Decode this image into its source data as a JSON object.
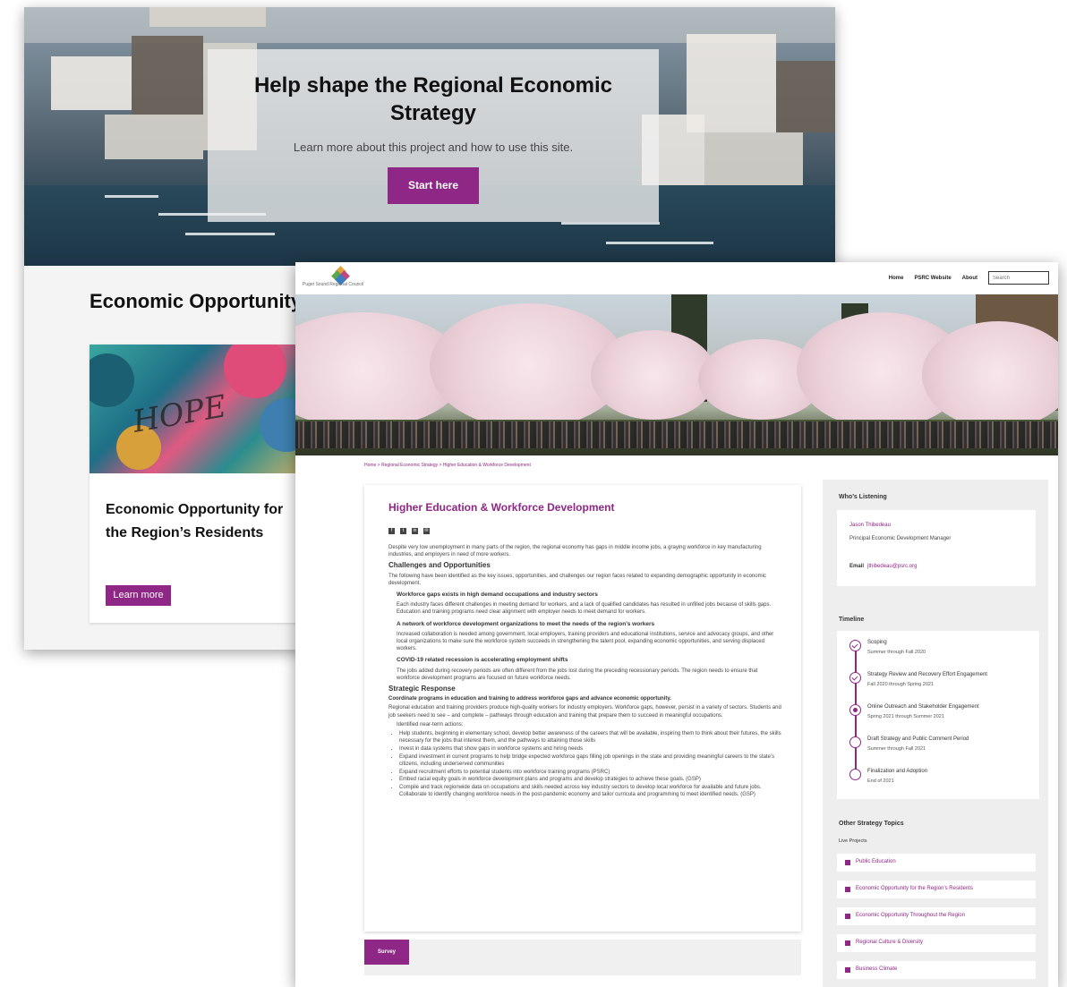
{
  "back": {
    "hero": {
      "title": "Help shape the Regional Economic Strategy",
      "subtitle": "Learn more about this project and how to use this site.",
      "button": "Start here"
    },
    "section_heading": "Economic Opportunity",
    "card": {
      "image_text": "HOPE",
      "title": "Economic Opportunity for the Region’s Residents",
      "button": "Learn more"
    }
  },
  "front": {
    "logo_text": "Puget Sound Regional Council",
    "nav": [
      "Home",
      "PSRC Website",
      "About"
    ],
    "search_placeholder": "Search",
    "breadcrumb": "Home  >  Regional Economic Strategy  >  Higher Education & Workforce Development",
    "article": {
      "title": "Higher Education & Workforce Development",
      "share_icons": [
        "facebook-icon",
        "twitter-icon",
        "linkedin-icon",
        "email-icon"
      ],
      "intro": "Despite very low unemployment in many parts of the region, the regional economy has gaps in middle income jobs, a graying workforce in key manufacturing industries, and employers in need of more workers.",
      "challenges_heading": "Challenges and Opportunities",
      "challenges_intro": "The following have been identified as the key issues, opportunities, and challenges our region faces related to expanding demographic opportunity in economic development.",
      "issues": [
        {
          "heading": "Workforce gaps exists in high demand occupations and industry sectors",
          "text": "Each industry faces different challenges in meeting demand for workers, and a lack of qualified candidates has resulted in unfilled jobs because of skills gaps. Education and training programs need clear alignment with employer needs to meet demand for workers."
        },
        {
          "heading": "A network of workforce development organizations to meet the needs of the region’s workers",
          "text": "Increased collaboration is needed among government, local employers, training providers and educational institutions, service and advocacy groups, and other local organizations to make sure the workforce system succeeds in strengthening the talent pool, expanding economic opportunities, and serving displaced workers."
        },
        {
          "heading": "COVID-19 related recession is accelerating employment shifts",
          "text": "The jobs added during recovery periods are often different from the jobs lost during the preceding recessionary periods. The region needs to ensure that workforce development programs are focused on future workforce needs."
        }
      ],
      "strategic_heading": "Strategic Response",
      "strategic_sub": "Coordinate programs in education and training to address workforce gaps and advance economic opportunity.",
      "strategic_text": "Regional education and training providers produce high-quality workers for industry employers. Workforce gaps, however, persist in a variety of sectors. Students and job seekers need to see – and complete – pathways through education and training that prepare them to succeed in meaningful occupations.",
      "actions_label": "Identified near-term actions:",
      "actions": [
        "Help students, beginning in elementary school, develop better awareness of the careers that will be available, inspiring them to think about their futures, the skills necessary for the jobs that interest them, and the pathways to attaining those skills",
        "Invest in data systems that show gaps in workforce systems and hiring needs",
        "Expand investment in current programs to help bridge expected workforce gaps filling job openings in the state and providing meaningful careers to the state’s citizens, including underserved communities",
        "Expand recruitment efforts to potential students into workforce training programs (PSRC)",
        "Embed racial equity goals in workforce development plans and programs and develop strategies to achieve these goals. (GSP)",
        "Compile and track regionwide data on occupations and skills needed across key industry sectors to develop local workforce for available and future jobs. Collaborate to identify changing workforce needs in the post-pandemic economy and tailor curricula and programming to meet identified needs. (GSP)"
      ]
    },
    "survey_button": "Survey",
    "sidebar": {
      "whos_listening_heading": "Who’s Listening",
      "contact_name": "Jason Thibedeau",
      "contact_role": "Principal Economic Development Manager",
      "email_label": "Email",
      "email": "jthibedeau@psrc.org",
      "timeline_heading": "Timeline",
      "timeline": [
        {
          "title": "Scoping",
          "date": "Summer through Fall 2020",
          "state": "done"
        },
        {
          "title": "Strategy Review and Recovery Effort Engagement",
          "date": "Fall 2020 through Spring 2021",
          "state": "done"
        },
        {
          "title": "Online Outreach and Stakeholder Engagement",
          "date": "Spring 2021 through Summer 2021",
          "state": "current"
        },
        {
          "title": "Draft Strategy and Public Comment Period",
          "date": "Summer through Fall 2021",
          "state": "upcoming"
        },
        {
          "title": "Finalization and Adoption",
          "date": "End of 2021",
          "state": "upcoming"
        }
      ],
      "other_heading": "Other Strategy Topics",
      "other_sub": "Live Projects",
      "topics": [
        "Public Education",
        "Economic Opportunity for the Region’s Residents",
        "Economic Opportunity Throughout the Region",
        "Regional Culture & Diversity",
        "Business Climate"
      ]
    }
  },
  "colors": {
    "accent": "#8e2785",
    "sidebar_bg": "#eeeeee"
  }
}
